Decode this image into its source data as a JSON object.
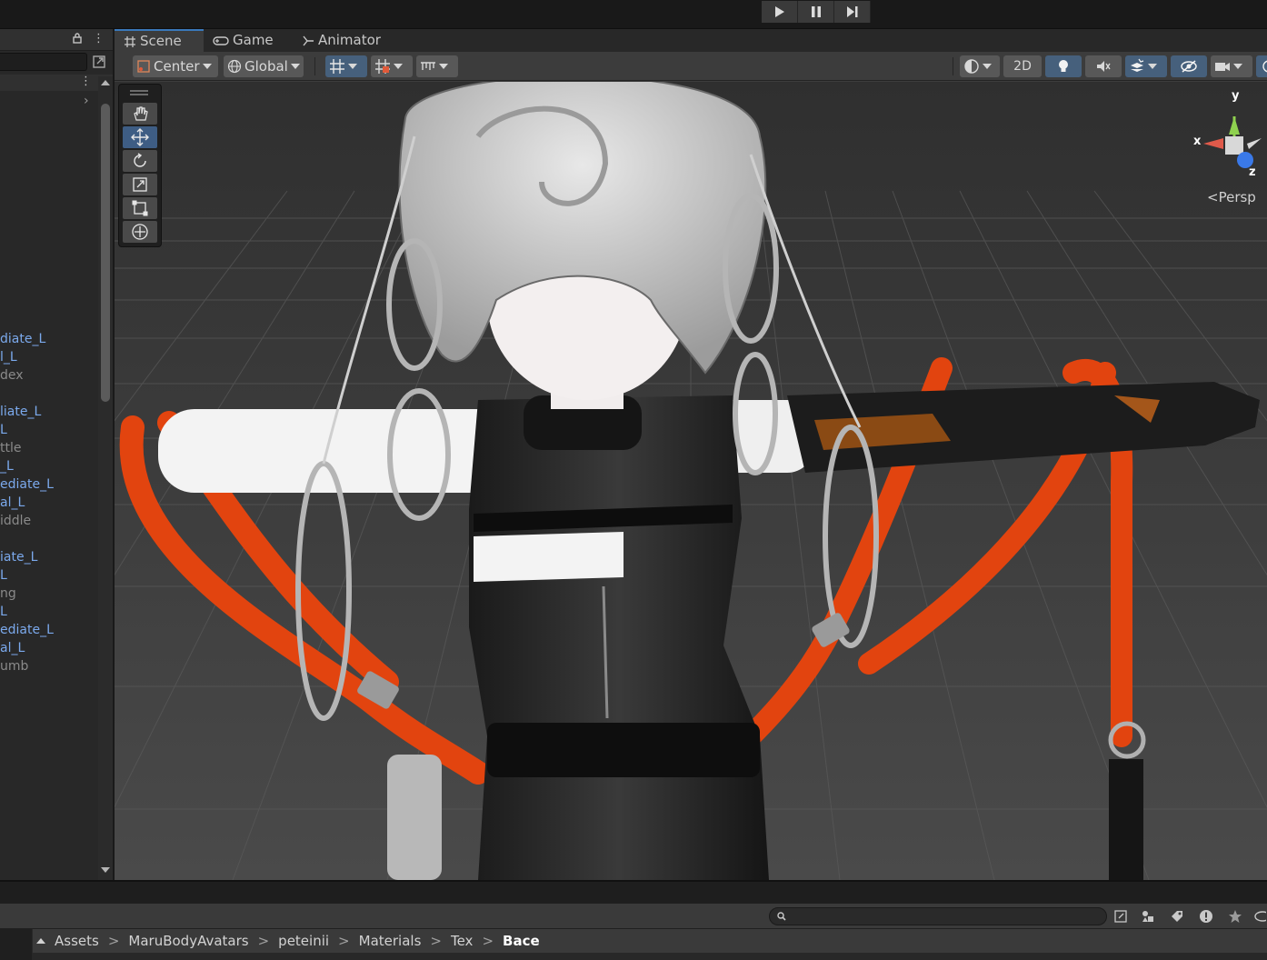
{
  "playbar": {
    "buttons": [
      "play",
      "pause",
      "step"
    ]
  },
  "hierarchy": {
    "items": [
      {
        "label": "diate_L",
        "style": "blue",
        "top": 0
      },
      {
        "label": "l_L",
        "style": "blue"
      },
      {
        "label": "dex",
        "style": "gray"
      },
      {
        "label": "liate_L",
        "style": "blue"
      },
      {
        "label": "L",
        "style": "blue"
      },
      {
        "label": "ttle",
        "style": "gray"
      },
      {
        "label": "_L",
        "style": "blue"
      },
      {
        "label": "ediate_L",
        "style": "blue"
      },
      {
        "label": "al_L",
        "style": "blue"
      },
      {
        "label": "iddle",
        "style": "gray"
      },
      {
        "label": "iate_L",
        "style": "blue"
      },
      {
        "label": "L",
        "style": "blue"
      },
      {
        "label": "ng",
        "style": "gray"
      },
      {
        "label": "L",
        "style": "blue"
      },
      {
        "label": "ediate_L",
        "style": "blue"
      },
      {
        "label": "al_L",
        "style": "blue"
      },
      {
        "label": "umb",
        "style": "gray"
      }
    ]
  },
  "tabs": {
    "scene": "Scene",
    "game": "Game",
    "animator": "Animator"
  },
  "scene_toolbar": {
    "pivot": "Center",
    "space": "Global",
    "mode_2d": "2D"
  },
  "gizmo": {
    "x": "x",
    "y": "y",
    "z": "z",
    "projection": "Persp"
  },
  "project": {
    "breadcrumb": [
      "Assets",
      "MaruBodyAvatars",
      "peteinii",
      "Materials",
      "Tex",
      "Bace"
    ],
    "separator": ">"
  },
  "colors": {
    "accent_blue": "#3a79bb",
    "strap_orange": "#e2440f",
    "hierarchy_blue": "#7ba9ec",
    "viewport_bg": "#3c3c3c"
  }
}
